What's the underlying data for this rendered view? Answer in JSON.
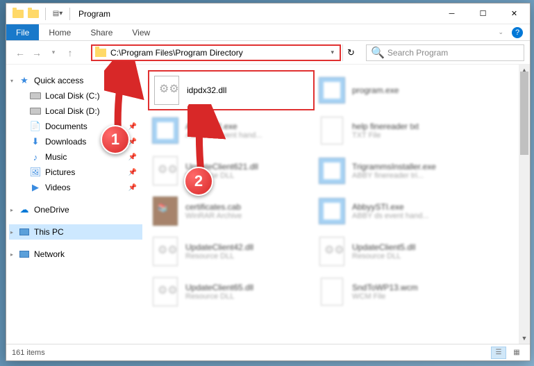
{
  "window": {
    "title": "Program"
  },
  "ribbon": {
    "file": "File",
    "tabs": [
      "Home",
      "Share",
      "View"
    ]
  },
  "addressbar": {
    "path": "C:\\Program Files\\Program Directory"
  },
  "search": {
    "placeholder": "Search Program"
  },
  "sidebar": {
    "quick_access": "Quick access",
    "items": [
      {
        "label": "Local Disk (C:)",
        "icon": "drive"
      },
      {
        "label": "Local Disk (D:)",
        "icon": "drive"
      },
      {
        "label": "Documents",
        "icon": "documents",
        "pinned": true
      },
      {
        "label": "Downloads",
        "icon": "downloads",
        "pinned": true
      },
      {
        "label": "Music",
        "icon": "music",
        "pinned": true
      },
      {
        "label": "Pictures",
        "icon": "pictures",
        "pinned": true
      },
      {
        "label": "Videos",
        "icon": "videos",
        "pinned": true
      }
    ],
    "onedrive": "OneDrive",
    "this_pc": "This PC",
    "network": "Network"
  },
  "files": [
    {
      "name": "idpdx32.dll",
      "sub": "",
      "icon": "dll",
      "highlighted": true
    },
    {
      "name": "program.exe",
      "sub": "",
      "icon": "exe",
      "blurred": true
    },
    {
      "name": "AbbyySTI.exe",
      "sub": "ABBY ds event hand...",
      "icon": "exe",
      "blurred": true
    },
    {
      "name": "help finereader txt",
      "sub": "TXT File",
      "icon": "txt",
      "blurred": true
    },
    {
      "name": "UpdateClient621.dll",
      "sub": "Resource DLL",
      "icon": "dll",
      "blurred": true
    },
    {
      "name": "TrigrammsInstaller.exe",
      "sub": "ABBY finereader tri...",
      "icon": "exe",
      "blurred": true
    },
    {
      "name": "certificates.cab",
      "sub": "WinRAR Archive",
      "icon": "cab",
      "blurred": true
    },
    {
      "name": "AbbyySTI.exe",
      "sub": "ABBY ds event hand...",
      "icon": "exe",
      "blurred": true
    },
    {
      "name": "UpdateClient42.dll",
      "sub": "Resource DLL",
      "icon": "dll",
      "blurred": true
    },
    {
      "name": "UpdateClient5.dll",
      "sub": "Resource DLL",
      "icon": "dll",
      "blurred": true
    },
    {
      "name": "UpdateClient65.dll",
      "sub": "Resource DLL",
      "icon": "dll",
      "blurred": true
    },
    {
      "name": "SndToWP13.wcm",
      "sub": "WCM File",
      "icon": "txt",
      "blurred": true
    }
  ],
  "status": {
    "item_count": "161 items"
  },
  "callouts": {
    "one": "1",
    "two": "2"
  }
}
